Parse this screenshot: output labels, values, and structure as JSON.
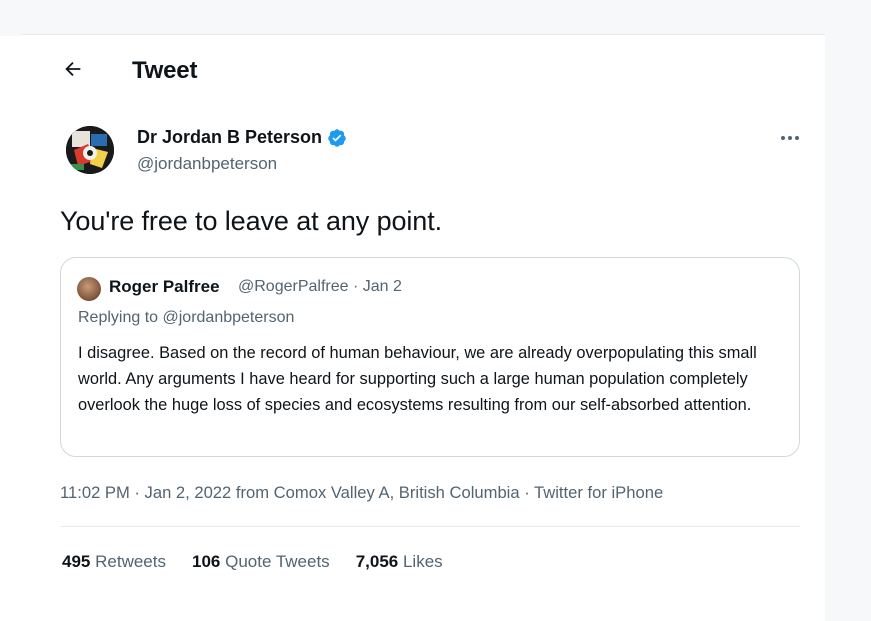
{
  "header": {
    "title": "Tweet"
  },
  "author": {
    "name": "Dr Jordan B Peterson",
    "handle": "@jordanbpeterson",
    "verified": true,
    "avatar_icon": "abstract-avatar"
  },
  "tweet": {
    "text": "You're free to leave at any point."
  },
  "quoted": {
    "name": "Roger Palfree",
    "meta": "@RogerPalfree · Jan 2",
    "replying_prefix": "Replying to ",
    "replying_handle": "@jordanbpeterson",
    "body": "I disagree. Based on the record of human behaviour, we are already overpopulating this small world. Any arguments I have heard for supporting such a large human population completely overlook the huge loss of species and ecosystems resulting from our self-absorbed attention."
  },
  "timestamp": "11:02 PM · Jan 2, 2022 from Comox Valley A, British Columbia · Twitter for iPhone",
  "stats": {
    "retweets_count": "495",
    "retweets_label": "Retweets",
    "quotes_count": "106",
    "quotes_label": "Quote Tweets",
    "likes_count": "7,056",
    "likes_label": "Likes"
  },
  "colors": {
    "verified": "#1d9bf0",
    "secondary_text": "#536471",
    "border": "#cfd9de"
  }
}
